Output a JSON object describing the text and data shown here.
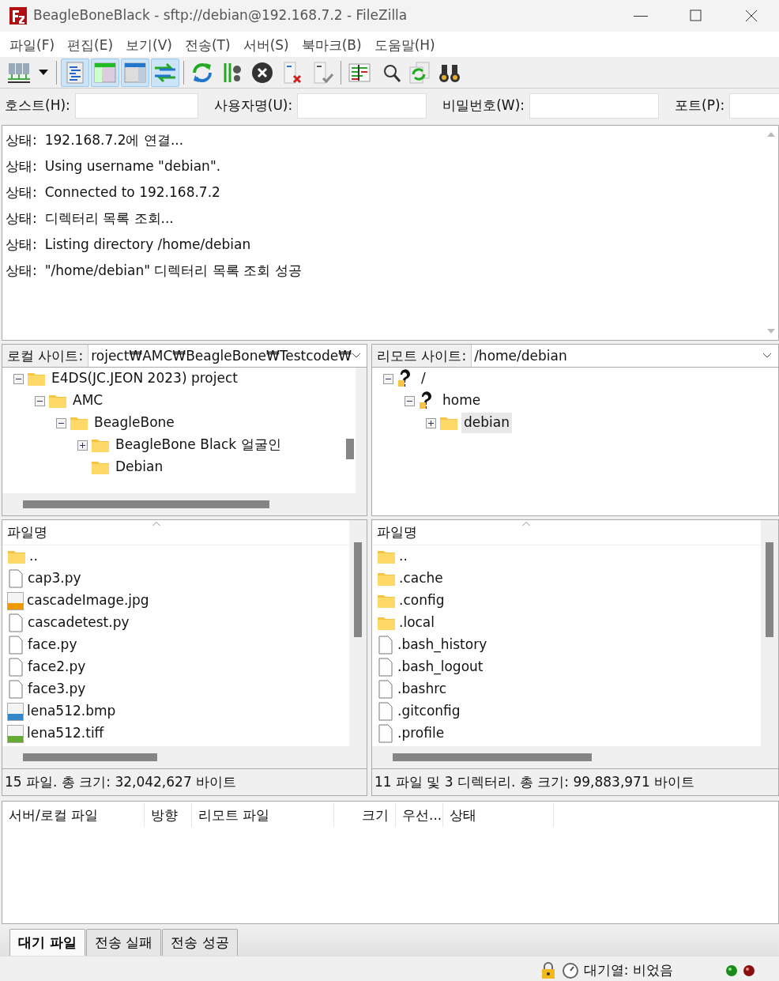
{
  "window": {
    "title": "BeagleBoneBlack - sftp://debian@192.168.7.2 - FileZilla"
  },
  "menu": [
    "파일(F)",
    "편집(E)",
    "보기(V)",
    "전송(T)",
    "서버(S)",
    "북마크(B)",
    "도움말(H)"
  ],
  "toolbar": [
    {
      "kind": "servers",
      "selected": false
    },
    {
      "kind": "caret",
      "selected": false
    },
    {
      "kind": "sep"
    },
    {
      "kind": "log",
      "selected": true
    },
    {
      "kind": "localtree",
      "selected": true
    },
    {
      "kind": "remotetree",
      "selected": true
    },
    {
      "kind": "queue",
      "selected": true
    },
    {
      "kind": "sep"
    },
    {
      "kind": "refresh",
      "selected": false
    },
    {
      "kind": "filter",
      "selected": false
    },
    {
      "kind": "cancel",
      "selected": false
    },
    {
      "kind": "disconnect",
      "selected": false
    },
    {
      "kind": "reconnect",
      "selected": false
    },
    {
      "kind": "sep"
    },
    {
      "kind": "compare",
      "selected": false
    },
    {
      "kind": "search",
      "selected": false
    },
    {
      "kind": "sync",
      "selected": false
    },
    {
      "kind": "binoculars",
      "selected": false
    }
  ],
  "quickconnect": [
    {
      "label": "호스트(H):"
    },
    {
      "label": "사용자명(U):"
    },
    {
      "label": "비밀번호(W):"
    },
    {
      "label": "포트(P):"
    }
  ],
  "log": [
    {
      "label": "상태:",
      "message": "192.168.7.2에 연결..."
    },
    {
      "label": "상태:",
      "message": "Using username \"debian\"."
    },
    {
      "label": "상태:",
      "message": "Connected to 192.168.7.2"
    },
    {
      "label": "상태:",
      "message": "디렉터리 목록 조회..."
    },
    {
      "label": "상태:",
      "message": "Listing directory /home/debian"
    },
    {
      "label": "상태:",
      "message": "\"/home/debian\" 디렉터리 목록 조회 성공"
    }
  ],
  "local": {
    "label": "로컬 사이트:",
    "path": "roject₩AMC₩BeagleBone₩Testcode₩",
    "tree": [
      {
        "label": "E4DS(JC.JEON 2023) project",
        "kind": "folder",
        "expanded": true,
        "selected": false,
        "children": [
          {
            "label": "AMC",
            "kind": "folder",
            "expanded": true,
            "selected": false,
            "children": [
              {
                "label": "BeagleBone",
                "kind": "folder",
                "expanded": true,
                "selected": false,
                "children": [
                  {
                    "label": "BeagleBone Black 얼굴인",
                    "kind": "folder",
                    "expanded": false,
                    "selected": false
                  },
                  {
                    "label": "Debian",
                    "kind": "folder",
                    "selected": false
                  }
                ]
              }
            ]
          }
        ]
      }
    ],
    "column": "파일명",
    "files": [
      {
        "name": "..",
        "kind": "folder"
      },
      {
        "name": "cap3.py",
        "kind": "file"
      },
      {
        "name": "cascadeImage.jpg",
        "kind": "jpg"
      },
      {
        "name": "cascadetest.py",
        "kind": "file"
      },
      {
        "name": "face.py",
        "kind": "file"
      },
      {
        "name": "face2.py",
        "kind": "file"
      },
      {
        "name": "face3.py",
        "kind": "file"
      },
      {
        "name": "lena512.bmp",
        "kind": "bmp"
      },
      {
        "name": "lena512.tiff",
        "kind": "tif"
      }
    ],
    "summary": "15 파일. 총 크기: 32,042,627 바이트"
  },
  "remote": {
    "label": "리모트 사이트:",
    "path": "/home/debian",
    "tree": [
      {
        "label": "/",
        "kind": "unknown",
        "expanded": true,
        "selected": false,
        "children": [
          {
            "label": "home",
            "kind": "unknown",
            "expanded": true,
            "selected": false,
            "children": [
              {
                "label": "debian",
                "kind": "folder",
                "expanded": false,
                "selected": true
              }
            ]
          }
        ]
      }
    ],
    "column": "파일명",
    "files": [
      {
        "name": "..",
        "kind": "folder"
      },
      {
        "name": ".cache",
        "kind": "folder"
      },
      {
        "name": ".config",
        "kind": "folder"
      },
      {
        "name": ".local",
        "kind": "folder"
      },
      {
        "name": ".bash_history",
        "kind": "file"
      },
      {
        "name": ".bash_logout",
        "kind": "file"
      },
      {
        "name": ".bashrc",
        "kind": "file"
      },
      {
        "name": ".gitconfig",
        "kind": "file"
      },
      {
        "name": ".profile",
        "kind": "file"
      }
    ],
    "summary": "11 파일 및 3 디렉터리. 총 크기: 99,883,971 바이트"
  },
  "queue": {
    "columns": [
      "서버/로컬 파일",
      "방향",
      "리모트 파일",
      "크기",
      "우선...",
      "상태"
    ]
  },
  "tabs": [
    {
      "label": "대기 파일",
      "selected": true
    },
    {
      "label": "전송 실패",
      "selected": false
    },
    {
      "label": "전송 성공",
      "selected": false
    }
  ],
  "status_bar": {
    "queue": "대기열: 비었음"
  }
}
